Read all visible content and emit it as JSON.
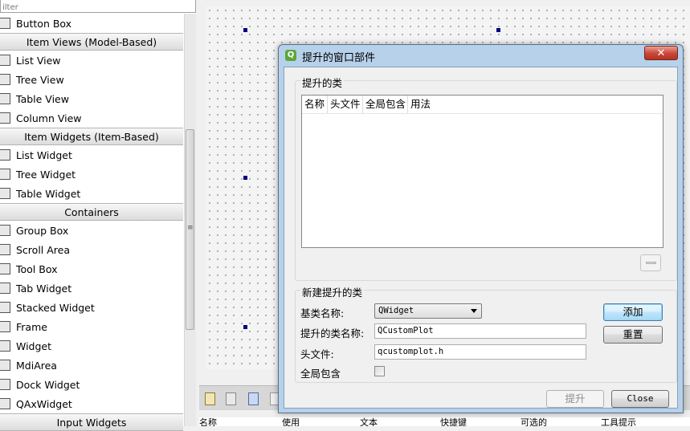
{
  "filter": {
    "placeholder": "ilter"
  },
  "widgetbox": [
    {
      "type": "item",
      "label": "Button Box",
      "icon": "button-box-icon"
    },
    {
      "type": "category",
      "label": "Item Views (Model-Based)"
    },
    {
      "type": "item",
      "label": "List View",
      "icon": "list-view-icon"
    },
    {
      "type": "item",
      "label": "Tree View",
      "icon": "tree-view-icon"
    },
    {
      "type": "item",
      "label": "Table View",
      "icon": "table-view-icon"
    },
    {
      "type": "item",
      "label": "Column View",
      "icon": "column-view-icon"
    },
    {
      "type": "category",
      "label": "Item Widgets (Item-Based)"
    },
    {
      "type": "item",
      "label": "List Widget",
      "icon": "list-widget-icon"
    },
    {
      "type": "item",
      "label": "Tree Widget",
      "icon": "tree-widget-icon"
    },
    {
      "type": "item",
      "label": "Table Widget",
      "icon": "table-widget-icon"
    },
    {
      "type": "category",
      "label": "Containers"
    },
    {
      "type": "item",
      "label": "Group Box",
      "icon": "group-box-icon"
    },
    {
      "type": "item",
      "label": "Scroll Area",
      "icon": "scroll-area-icon"
    },
    {
      "type": "item",
      "label": "Tool Box",
      "icon": "tool-box-icon"
    },
    {
      "type": "item",
      "label": "Tab Widget",
      "icon": "tab-widget-icon"
    },
    {
      "type": "item",
      "label": "Stacked Widget",
      "icon": "stacked-widget-icon"
    },
    {
      "type": "item",
      "label": "Frame",
      "icon": "frame-icon"
    },
    {
      "type": "item",
      "label": "Widget",
      "icon": "widget-icon"
    },
    {
      "type": "item",
      "label": "MdiArea",
      "icon": "mdi-area-icon"
    },
    {
      "type": "item",
      "label": "Dock Widget",
      "icon": "dock-widget-icon"
    },
    {
      "type": "item",
      "label": "QAxWidget",
      "icon": "qax-widget-icon"
    },
    {
      "type": "category",
      "label": "Input Widgets"
    }
  ],
  "scrollbar": {
    "grip": "≡"
  },
  "bottom_headers": [
    "名称",
    "使用",
    "文本",
    "快捷键",
    "可选的",
    "工具提示"
  ],
  "dialog": {
    "icon": "Q",
    "title": "提升的窗口部件",
    "close": "✕",
    "promoted_group": "提升的类",
    "columns": [
      "名称",
      "头文件",
      "全局包含",
      "用法"
    ],
    "new_group": "新建提升的类",
    "base_class_label": "基类名称:",
    "base_class_value": "QWidget",
    "promoted_name_label": "提升的类名称:",
    "promoted_name_value": "QCustomPlot",
    "header_label": "头文件:",
    "header_value": "qcustomplot.h",
    "global_include_label": "全局包含",
    "global_include_checked": false,
    "add_button": "添加",
    "reset_button": "重置",
    "promote_button": "提升",
    "close_button": "Close"
  }
}
